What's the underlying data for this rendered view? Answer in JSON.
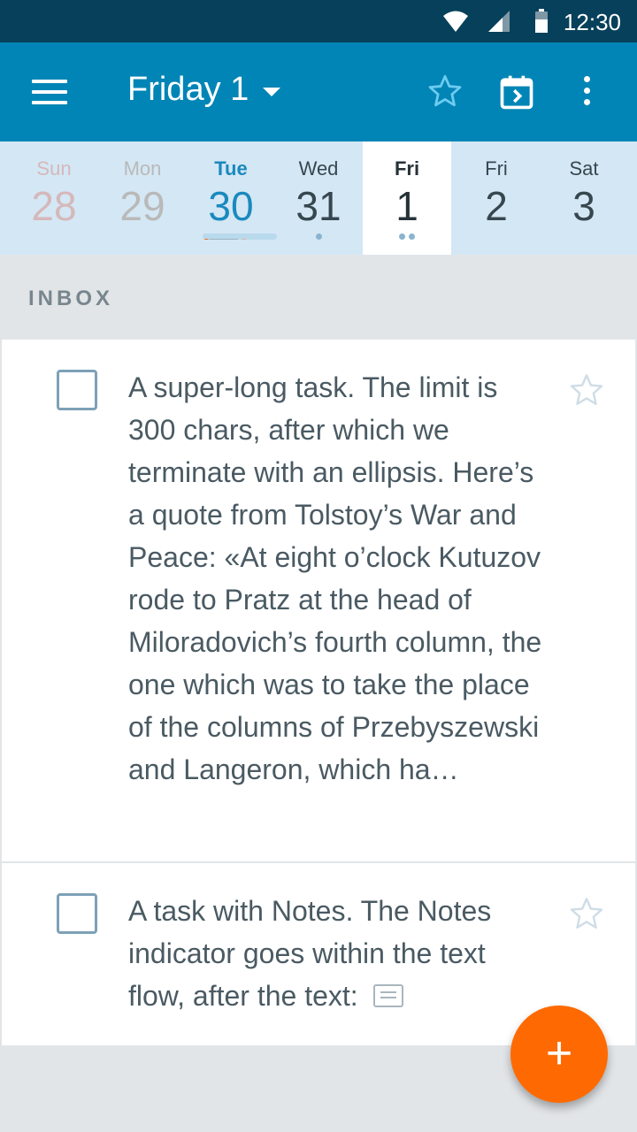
{
  "status_bar": {
    "time": "12:30",
    "icons": [
      "wifi-icon",
      "signal-icon",
      "battery-icon"
    ]
  },
  "app_bar": {
    "title": "Friday 1",
    "icons": [
      "menu-icon",
      "star-icon",
      "calendar-icon",
      "more-icon"
    ]
  },
  "week": [
    {
      "name": "Sun",
      "num": "28",
      "state": "past sun"
    },
    {
      "name": "Mon",
      "num": "29",
      "state": "past"
    },
    {
      "name": "Tue",
      "num": "30",
      "state": "today"
    },
    {
      "name": "Wed",
      "num": "31",
      "state": "normal"
    },
    {
      "name": "Fri",
      "num": "1",
      "state": "selected"
    },
    {
      "name": "Fri",
      "num": "2",
      "state": "normal"
    },
    {
      "name": "Sat",
      "num": "3",
      "state": "normal"
    }
  ],
  "inbox": {
    "label": "INBOX",
    "tasks": [
      {
        "text": "A super-long task. The limit is 300 chars, after which we terminate with an ellipsis. Here’s a quote from Tolstoy’s War and Peace: «At eight o’clock Kutuzov rode to Pratz at the head of Miloradovich’s fourth column, the one which was to take the place of the columns of Przebyszewski and Langeron, which ha…"
      },
      {
        "text": "A task with Notes. The Notes indicator goes within the text flow, after the text:"
      }
    ]
  },
  "fab": {
    "label": "+"
  },
  "colors": {
    "status_bar": "#07405a",
    "app_bar": "#0185b6",
    "accent": "#fe6a01",
    "week_strip": "#d4e7f4"
  }
}
